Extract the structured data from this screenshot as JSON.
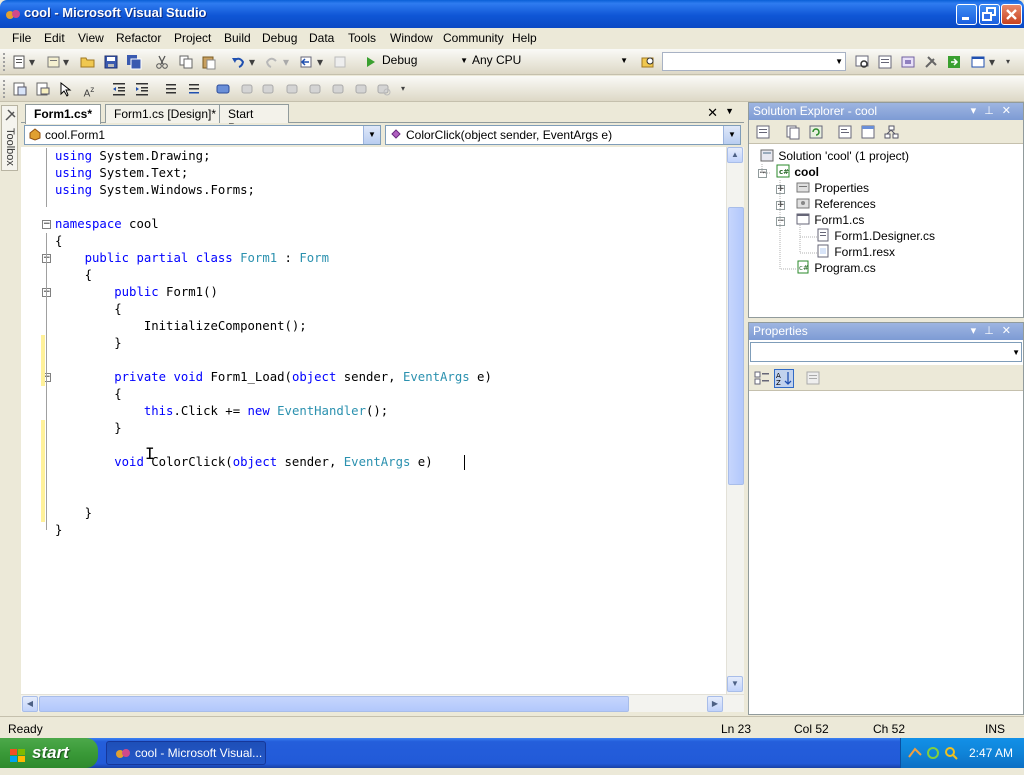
{
  "window": {
    "title": "cool - Microsoft Visual Studio"
  },
  "menu": [
    "File",
    "Edit",
    "View",
    "Refactor",
    "Project",
    "Build",
    "Debug",
    "Data",
    "Tools",
    "Window",
    "Community",
    "Help"
  ],
  "toolbar": {
    "config": "Debug",
    "platform": "Any CPU",
    "find_value": ""
  },
  "toolbox": {
    "label": "Toolbox"
  },
  "editor": {
    "tabs": [
      "Form1.cs*",
      "Form1.cs [Design]*",
      "Start Page"
    ],
    "active_tab": "Form1.cs*",
    "nav_type": "cool.Form1",
    "nav_member": "ColorClick(object sender, EventArgs e)"
  },
  "code": [
    [
      {
        "t": "using",
        "k": "kw"
      },
      {
        "t": " System.Drawing;"
      }
    ],
    [
      {
        "t": "using",
        "k": "kw"
      },
      {
        "t": " System.Text;"
      }
    ],
    [
      {
        "t": "using",
        "k": "kw"
      },
      {
        "t": " System.Windows.Forms;"
      }
    ],
    [],
    [
      {
        "t": "namespace",
        "k": "kw"
      },
      {
        "t": " cool"
      }
    ],
    [
      {
        "t": "{"
      }
    ],
    [
      {
        "t": "    "
      },
      {
        "t": "public",
        "k": "kw"
      },
      {
        "t": " "
      },
      {
        "t": "partial",
        "k": "kw"
      },
      {
        "t": " "
      },
      {
        "t": "class",
        "k": "kw"
      },
      {
        "t": " "
      },
      {
        "t": "Form1",
        "k": "ty"
      },
      {
        "t": " : "
      },
      {
        "t": "Form",
        "k": "ty"
      }
    ],
    [
      {
        "t": "    {"
      }
    ],
    [
      {
        "t": "        "
      },
      {
        "t": "public",
        "k": "kw"
      },
      {
        "t": " Form1()"
      }
    ],
    [
      {
        "t": "        {"
      }
    ],
    [
      {
        "t": "            InitializeComponent();"
      }
    ],
    [
      {
        "t": "        }"
      }
    ],
    [],
    [
      {
        "t": "        "
      },
      {
        "t": "private",
        "k": "kw"
      },
      {
        "t": " "
      },
      {
        "t": "void",
        "k": "kw"
      },
      {
        "t": " Form1_Load("
      },
      {
        "t": "object",
        "k": "kw"
      },
      {
        "t": " sender, "
      },
      {
        "t": "EventArgs",
        "k": "ty"
      },
      {
        "t": " e)"
      }
    ],
    [
      {
        "t": "        {"
      }
    ],
    [
      {
        "t": "            "
      },
      {
        "t": "this",
        "k": "kw"
      },
      {
        "t": ".Click += "
      },
      {
        "t": "new",
        "k": "kw"
      },
      {
        "t": " "
      },
      {
        "t": "EventHandler",
        "k": "ty"
      },
      {
        "t": "();"
      }
    ],
    [
      {
        "t": "        }"
      }
    ],
    [],
    [
      {
        "t": "        "
      },
      {
        "t": "void",
        "k": "kw"
      },
      {
        "t": " ColorClick("
      },
      {
        "t": "object",
        "k": "kw"
      },
      {
        "t": " sender, "
      },
      {
        "t": "EventArgs",
        "k": "ty"
      },
      {
        "t": " e)"
      }
    ],
    [],
    [],
    [
      {
        "t": "    }"
      }
    ],
    [
      {
        "t": "}"
      }
    ]
  ],
  "solution_explorer": {
    "title": "Solution Explorer - cool",
    "items": [
      {
        "label": "Solution 'cool' (1 project)",
        "icon": "solution-icon"
      },
      {
        "label": "cool",
        "icon": "csharp-project-icon"
      },
      {
        "label": "Properties",
        "icon": "properties-folder-icon"
      },
      {
        "label": "References",
        "icon": "references-folder-icon"
      },
      {
        "label": "Form1.cs",
        "icon": "form-icon"
      },
      {
        "label": "Form1.Designer.cs",
        "icon": "cs-file-icon"
      },
      {
        "label": "Form1.resx",
        "icon": "resx-file-icon"
      },
      {
        "label": "Program.cs",
        "icon": "cs-file-icon"
      }
    ]
  },
  "properties": {
    "title": "Properties"
  },
  "status": {
    "state": "Ready",
    "ln": "Ln 23",
    "col": "Col 52",
    "ch": "Ch 52",
    "mode": "INS"
  },
  "taskbar": {
    "start": "start",
    "task": "cool - Microsoft Visual...",
    "clock": "2:47 AM"
  },
  "colors": {
    "keyword": "#0000ff",
    "type": "#2b91af",
    "change_marker": "#fff19a"
  }
}
